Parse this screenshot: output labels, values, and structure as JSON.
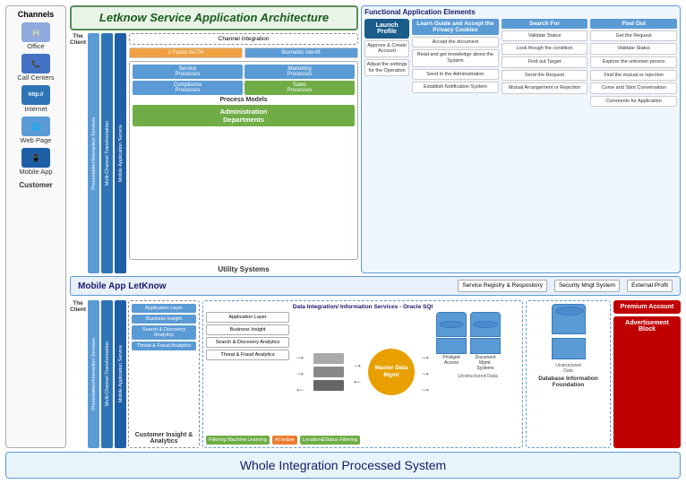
{
  "title": "Letknow Service Application Architecture",
  "channels": {
    "header": "Channels",
    "items": [
      {
        "label": "Office",
        "color": "#8faadc"
      },
      {
        "label": "Call Centers",
        "color": "#4472c4"
      },
      {
        "label": "Internet",
        "color": "#2e75b6"
      },
      {
        "label": "Web Page",
        "color": "#1f5fa6"
      },
      {
        "label": "Mobile App",
        "color": "#5b9bd5"
      }
    ],
    "customer_label": "Customer"
  },
  "functional": {
    "title": "Functional\nApplication\nElements",
    "launch_profile": "Launch\nProfile",
    "columns": [
      {
        "header": "Learn Guide\nand Accept\nthe Privacy\nCookies",
        "items": [
          "Accept the document",
          "Read and get knowledge about the System",
          "Send to the Administrator",
          "Establish Notification System",
          "Adjust the settings for the Operation"
        ]
      },
      {
        "header": "Search For",
        "items": [
          "Validate Status",
          "Look though the condition",
          "Find out Target",
          "Send the Request",
          "Mutual Arrangement or Rejection"
        ]
      },
      {
        "header": "Find Out",
        "items": [
          "Get the Request",
          "Validate Status",
          "Explore the unknown person",
          "Find the mutual or rejection",
          "Come and Start Conversation",
          "Comments for Application"
        ]
      }
    ]
  },
  "utility": {
    "title": "Utility\nSystems",
    "channel_integration": "Channel\nIntegration",
    "two_factor": "2 Factor\nAUTH",
    "biometric": "Biometric\nIdentif.",
    "processes": [
      {
        "label": "Service\nProcesses",
        "color": "blue"
      },
      {
        "label": "Marketing\nProcesses",
        "color": "blue"
      },
      {
        "label": "Compliance\nProcesses",
        "color": "blue"
      },
      {
        "label": "Sales\nProcesses",
        "color": "green"
      }
    ],
    "process_models": "Process Models",
    "admin_dept": "Administration\nDepartments"
  },
  "mobile_app": {
    "title": "Mobile App LetKnow",
    "service_registry": "Service Registry &\nRespository",
    "security_mgmt": "Security Mngt\nSystem",
    "external_profit": "External Profit"
  },
  "bars": [
    {
      "label": "Presentation/Interaction Services",
      "color": "#5b9bd5"
    },
    {
      "label": "Multi-Channel Transformation",
      "color": "#2e75b6"
    },
    {
      "label": "Mobile Application Service",
      "color": "#1f5fa6"
    }
  ],
  "customer_insight": {
    "title": "Customer\nInsight\n& Analytics",
    "items": [
      "Application Layer",
      "Business\nInsight",
      "Search &\nDiscovery\nAnalytics",
      "Threat &\nFraud\nAnalytics"
    ]
  },
  "data_integration": {
    "title": "Data Integration/\nInformation Services -\nOracle SQl",
    "master_data": "Master\nData\nMgmt",
    "databases": [
      {
        "label": "Privilged\nAccess",
        "color": "#5b9bd5"
      },
      {
        "label": "Document\nMgmt.\nSystems",
        "color": "#5b9bd5"
      }
    ],
    "unstructured": "Unstructured\nData",
    "filtering": "Filtering\nMachine\nLearning",
    "ai_helper": "AI helper",
    "location": "Location&Status\nFiltering"
  },
  "db_foundation": {
    "title": "Database\nInformation\nFoundation"
  },
  "premium": {
    "account": "Premium\nAccount",
    "advert": "Advertisement\nBlock"
  },
  "bottom_banner": "Whole Integration Processed System",
  "the_client": "The\nClient"
}
